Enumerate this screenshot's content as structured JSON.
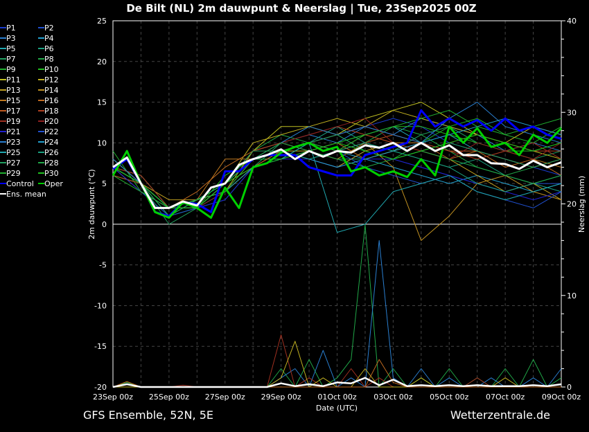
{
  "chart_data": {
    "type": "line",
    "title": "De Bilt  (NL)  2m dauwpunt & Neerslag | Tue, 23Sep2025 00Z",
    "xlabel": "Date (UTC)",
    "ylabel": "2m dauwpunt (°C)",
    "y2label": "Neerslag (mm)",
    "ylim": [
      -20,
      25
    ],
    "y2lim": [
      0,
      40
    ],
    "yticks": [
      "25",
      "20",
      "15",
      "10",
      "5",
      "0",
      "-5",
      "-10",
      "-15",
      "-20"
    ],
    "y2ticks": [
      "40",
      "30",
      "20",
      "10",
      "0"
    ],
    "xticks": [
      "23Sep 00z",
      "25Sep 00z",
      "27Sep 00z",
      "29Sep 00z",
      "01Oct 00z",
      "03Oct 00z",
      "05Oct 00z",
      "07Oct 00z",
      "09Oct 00z"
    ],
    "x_range_hours": [
      0,
      384
    ],
    "grid": true,
    "legend_position": "left-outside",
    "footer_left": "GFS Ensemble, 52N, 5E",
    "footer_right": "Wetterzentrale.de",
    "main_step_hours": 12,
    "member_step_hours": 24,
    "main_series": [
      {
        "name": "Control",
        "color": "#0000ff",
        "values": [
          6.8,
          8,
          5,
          1.5,
          1,
          2.7,
          2.5,
          1.5,
          6.5,
          6.5,
          8,
          8.5,
          8.5,
          8.5,
          7,
          6.5,
          6,
          6,
          8.5,
          9,
          9.5,
          10,
          14,
          12,
          13,
          12,
          12.8,
          11.5,
          13,
          11.5,
          12,
          11,
          10.5
        ]
      },
      {
        "name": "Oper",
        "color": "#00d000",
        "values": [
          6,
          9,
          5,
          1.5,
          0.8,
          2.7,
          2,
          0.8,
          4.5,
          2,
          7,
          7.5,
          8.8,
          9.5,
          10,
          9,
          9.5,
          6.5,
          7,
          6,
          6.5,
          5.8,
          8,
          6,
          12,
          10,
          11.8,
          9.5,
          10,
          8.5,
          11,
          10,
          11.8
        ]
      },
      {
        "name": "Ens. mean",
        "color": "#ffffff",
        "values": [
          7,
          8.2,
          5,
          2,
          2,
          2.8,
          2.3,
          4.5,
          5,
          7.3,
          8,
          8.5,
          9.2,
          8,
          9,
          8.3,
          9,
          8.8,
          9.7,
          9.4,
          10,
          9,
          10,
          9,
          9.7,
          8.5,
          8.5,
          7.5,
          7.4,
          6.8,
          7.8,
          7,
          7.6
        ]
      }
    ],
    "members": [
      {
        "name": "P1",
        "color": "#1a3ccf",
        "values": [
          7,
          5,
          2,
          2,
          5,
          8,
          9,
          10,
          11,
          12,
          13,
          12,
          10,
          9,
          8,
          7,
          6
        ]
      },
      {
        "name": "P2",
        "color": "#1f4fd1",
        "values": [
          7,
          4,
          1,
          3,
          4,
          7,
          9,
          8,
          7,
          9,
          8,
          7,
          6,
          5,
          4,
          5,
          5
        ]
      },
      {
        "name": "P3",
        "color": "#2a7fd0",
        "values": [
          8,
          5,
          2,
          3,
          5,
          9,
          10,
          11,
          10,
          12,
          11,
          13,
          12,
          11,
          9,
          10,
          9
        ]
      },
      {
        "name": "P4",
        "color": "#22a0d0",
        "values": [
          7,
          6,
          2,
          2,
          4,
          8,
          9,
          8,
          9,
          8,
          7,
          6,
          5,
          6,
          5,
          4,
          5
        ]
      },
      {
        "name": "P5",
        "color": "#20a8b0",
        "values": [
          7,
          5,
          1,
          3,
          5,
          8,
          8,
          9,
          10,
          11,
          12,
          10,
          11,
          9,
          8,
          7,
          8
        ]
      },
      {
        "name": "P6",
        "color": "#1aa080",
        "values": [
          6,
          5,
          2,
          2,
          3,
          7,
          9,
          10,
          12,
          10,
          9,
          8,
          7,
          8,
          6,
          5,
          4
        ]
      },
      {
        "name": "P7",
        "color": "#20a060",
        "values": [
          8,
          5,
          0,
          2,
          4,
          7,
          10,
          9,
          8,
          8,
          9,
          11,
          12,
          10,
          9,
          8,
          9
        ]
      },
      {
        "name": "P8",
        "color": "#20a848",
        "values": [
          7,
          5,
          2,
          3,
          5,
          9,
          11,
          10,
          9,
          10,
          12,
          11,
          9,
          7,
          6,
          7,
          8
        ]
      },
      {
        "name": "P9",
        "color": "#20b030",
        "values": [
          9,
          4,
          2,
          3,
          5,
          8,
          8,
          10,
          11,
          9,
          8,
          10,
          12,
          13,
          11,
          10,
          12
        ]
      },
      {
        "name": "P10",
        "color": "#20c020",
        "values": [
          7,
          5,
          1,
          2,
          6,
          8,
          9,
          9,
          10,
          11,
          12,
          12,
          11,
          10,
          9,
          9,
          10
        ]
      },
      {
        "name": "P11",
        "color": "#c0c020",
        "values": [
          7,
          6,
          2,
          3,
          4,
          9,
          12,
          12,
          11,
          13,
          14,
          15,
          13,
          11,
          10,
          9,
          8
        ]
      },
      {
        "name": "P12",
        "color": "#c0b020",
        "values": [
          7,
          5,
          2,
          2,
          5,
          10,
          11,
          12,
          13,
          12,
          14,
          13,
          12,
          11,
          10,
          12,
          11
        ]
      },
      {
        "name": "P13",
        "color": "#c0a020",
        "values": [
          8,
          5,
          3,
          3,
          4,
          8,
          9,
          8,
          7,
          9,
          10,
          9,
          8,
          6,
          4,
          5,
          3
        ]
      },
      {
        "name": "P14",
        "color": "#c09020",
        "values": [
          7,
          4,
          2,
          2,
          5,
          7,
          9,
          9,
          8,
          10,
          7,
          -2,
          1,
          5,
          6,
          4,
          3
        ]
      },
      {
        "name": "P15",
        "color": "#c07a20",
        "values": [
          7,
          5,
          2,
          3,
          8,
          8,
          9,
          10,
          9,
          11,
          10,
          10,
          9,
          8,
          9,
          8,
          7
        ]
      },
      {
        "name": "P16",
        "color": "#c06a20",
        "values": [
          7,
          5,
          2,
          4,
          7,
          9,
          10,
          9,
          10,
          8,
          9,
          10,
          8,
          9,
          7,
          8,
          6
        ]
      },
      {
        "name": "P17",
        "color": "#c05a20",
        "values": [
          6,
          5,
          2,
          3,
          4,
          7,
          9,
          10,
          9,
          10,
          11,
          10,
          9,
          9,
          8,
          7,
          8
        ]
      },
      {
        "name": "P18",
        "color": "#b04020",
        "values": [
          7,
          5,
          2,
          2,
          5,
          9,
          10,
          11,
          12,
          11,
          10,
          9,
          10,
          11,
          10,
          9,
          9
        ]
      },
      {
        "name": "P19",
        "color": "#a03020",
        "values": [
          7,
          6,
          2,
          3,
          4,
          8,
          9,
          10,
          11,
          12,
          11,
          10,
          9,
          8,
          9,
          10,
          8
        ]
      },
      {
        "name": "P20",
        "color": "#902020",
        "values": [
          7,
          5,
          2,
          2,
          4,
          8,
          10,
          11,
          12,
          13,
          10,
          9,
          8,
          10,
          9,
          8,
          10
        ]
      },
      {
        "name": "P21",
        "color": "#2020d0",
        "values": [
          7,
          4,
          2,
          2,
          3,
          7,
          8,
          8,
          7,
          8,
          8,
          7,
          6,
          5,
          4,
          3,
          4
        ]
      },
      {
        "name": "P22",
        "color": "#2050d0",
        "values": [
          7,
          5,
          1,
          2,
          5,
          8,
          9,
          10,
          9,
          7,
          6,
          5,
          6,
          4,
          3,
          2,
          4
        ]
      },
      {
        "name": "P23",
        "color": "#2a7fd0",
        "values": [
          8,
          5,
          2,
          3,
          5,
          8,
          10,
          12,
          11,
          12,
          11,
          10,
          13,
          15,
          12,
          11,
          10
        ]
      },
      {
        "name": "P24",
        "color": "#22a0d0",
        "values": [
          7,
          5,
          2,
          3,
          5,
          8,
          9,
          8,
          7,
          8,
          9,
          10,
          11,
          12,
          13,
          12,
          11
        ]
      },
      {
        "name": "P25",
        "color": "#20a8b0",
        "values": [
          7,
          5,
          2,
          3,
          4,
          7,
          8,
          10,
          -1,
          0,
          4,
          5,
          6,
          4,
          3,
          4,
          5
        ]
      },
      {
        "name": "P26",
        "color": "#1aa080",
        "values": [
          7,
          5,
          2,
          3,
          5,
          8,
          9,
          8,
          9,
          10,
          9,
          8,
          7,
          5,
          4,
          5,
          6
        ]
      },
      {
        "name": "P27",
        "color": "#20a060",
        "values": [
          7,
          5,
          2,
          2,
          5,
          9,
          9,
          10,
          11,
          9,
          8,
          9,
          10,
          9,
          8,
          7,
          8
        ]
      },
      {
        "name": "P28",
        "color": "#20a848",
        "values": [
          7,
          5,
          1,
          3,
          5,
          8,
          10,
          9,
          8,
          7,
          8,
          9,
          8,
          7,
          6,
          5,
          6
        ]
      },
      {
        "name": "P29",
        "color": "#20b030",
        "values": [
          6,
          4,
          2,
          3,
          4,
          8,
          9,
          10,
          9,
          11,
          12,
          13,
          14,
          12,
          11,
          12,
          13
        ]
      },
      {
        "name": "P30",
        "color": "#20c020",
        "values": [
          7,
          5,
          2,
          2,
          5,
          7,
          8,
          9,
          10,
          9,
          8,
          9,
          10,
          11,
          10,
          9,
          10
        ]
      }
    ],
    "precip_step_hours": 12,
    "precip_mean": {
      "name": "Ens. mean precip",
      "color": "#ffffff",
      "values": [
        0,
        0.3,
        0,
        0,
        0,
        0,
        0,
        0,
        0,
        0,
        0,
        0,
        0.4,
        0.1,
        0.3,
        0.1,
        0.5,
        0.4,
        1,
        0.2,
        0.8,
        0.1,
        0.2,
        0.1,
        0.2,
        0.1,
        0.2,
        0.1,
        0.1,
        0.1,
        0.2,
        0.1,
        0.3
      ]
    },
    "precip_members": [
      {
        "name": "P8",
        "color": "#20a848",
        "values": [
          0,
          0.5,
          0,
          0,
          0,
          0,
          0,
          0,
          0,
          0,
          0,
          0,
          2,
          0,
          3,
          0,
          1,
          3,
          17.7,
          0,
          2,
          0,
          1,
          0,
          2,
          0,
          1,
          0,
          2,
          0,
          3,
          0,
          1
        ]
      },
      {
        "name": "P23",
        "color": "#2a7fd0",
        "values": [
          0,
          0.3,
          0,
          0,
          0,
          0,
          0,
          0,
          0,
          0,
          0,
          0,
          1,
          2,
          0,
          4,
          0,
          1,
          0,
          16,
          1,
          0,
          2,
          0,
          1,
          0,
          0,
          1,
          0,
          0,
          1,
          0,
          2
        ]
      },
      {
        "name": "P19",
        "color": "#a03020",
        "values": [
          0,
          0,
          0,
          0,
          0,
          0.2,
          0,
          0,
          0,
          0,
          0,
          0,
          5.7,
          0,
          1,
          0,
          0,
          2,
          0,
          1,
          0,
          0,
          0,
          0,
          0,
          0,
          1,
          0,
          0,
          0,
          0,
          0,
          0
        ]
      },
      {
        "name": "P12",
        "color": "#c0b020",
        "values": [
          0,
          0,
          0,
          0,
          0,
          0,
          0,
          0,
          0,
          0,
          0,
          0,
          1,
          5,
          0,
          1,
          0,
          0,
          2,
          0,
          0,
          0,
          1,
          0,
          0,
          0,
          0,
          0,
          1,
          0,
          0,
          0,
          0
        ]
      },
      {
        "name": "P16",
        "color": "#c06a20",
        "values": [
          0,
          0.6,
          0,
          0,
          0,
          0,
          0,
          0,
          0,
          0,
          0,
          0,
          0,
          0,
          0,
          0,
          0,
          0,
          0,
          3,
          0.5,
          0,
          0,
          0,
          0,
          0,
          0,
          0,
          0,
          0,
          0,
          0,
          0
        ]
      }
    ]
  }
}
